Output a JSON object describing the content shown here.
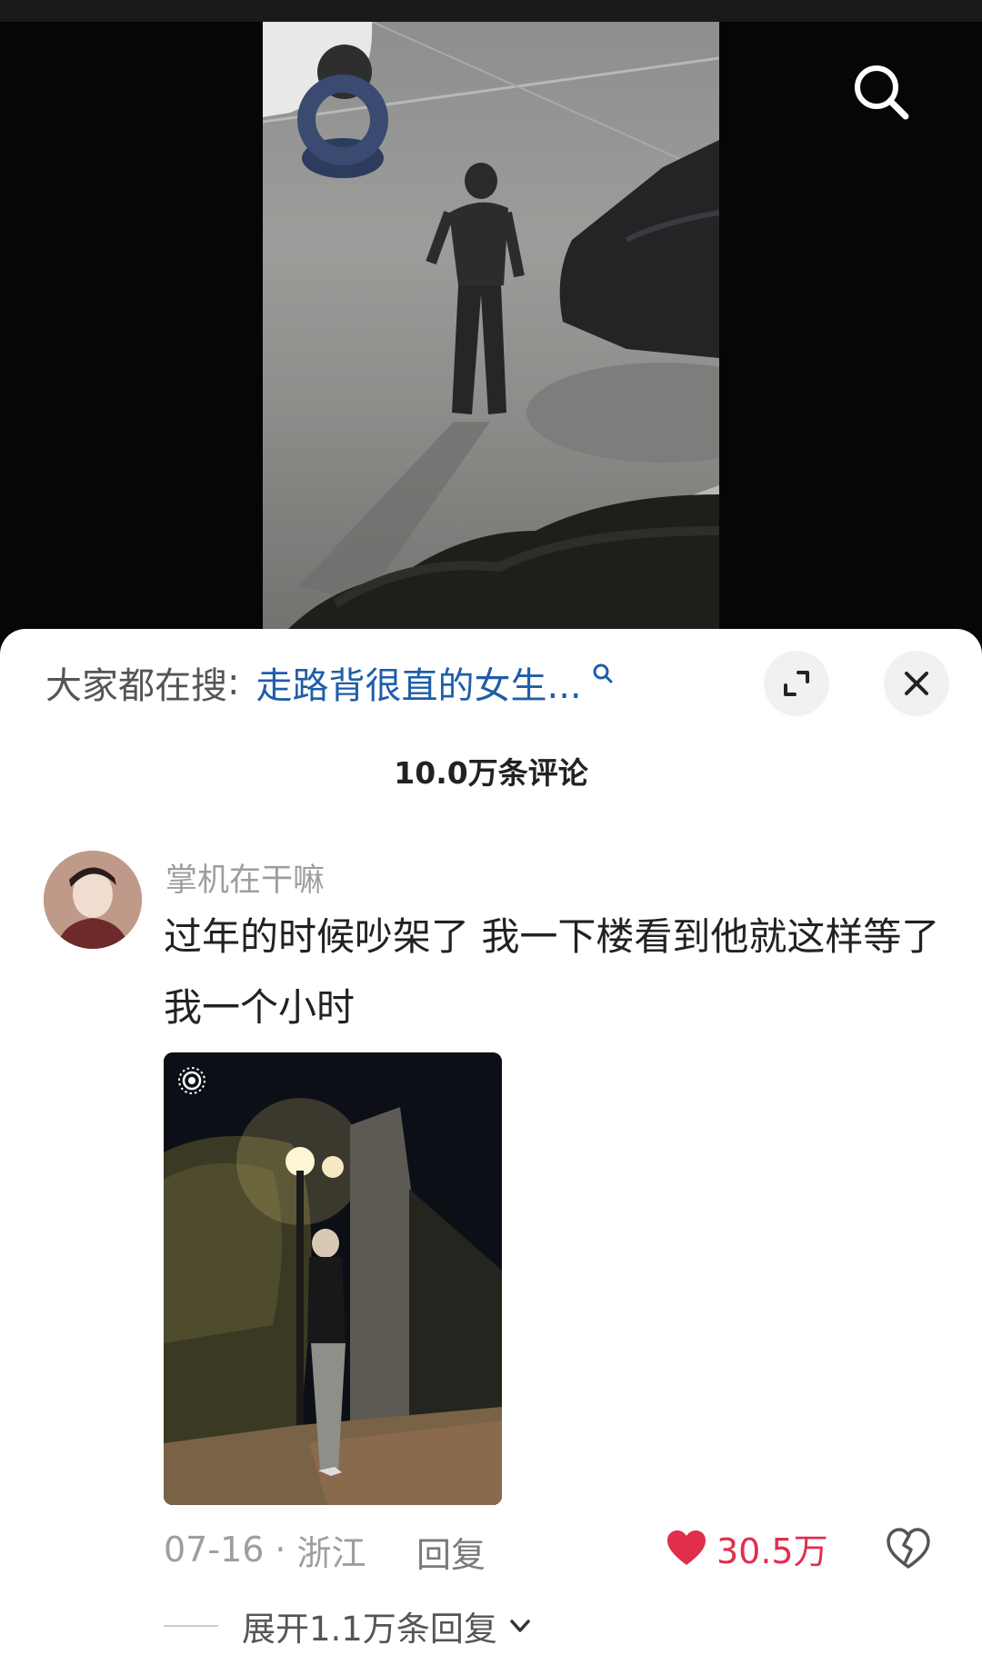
{
  "search": {
    "prefix": "大家都在搜",
    "colon": ":",
    "query": "走路背很直的女生..."
  },
  "comments_header": {
    "count_label": "10.0万条评论"
  },
  "comment": {
    "username": "掌机在干嘛",
    "text": "过年的时候吵架了 我一下楼看到他就这样等了我一个小时",
    "date": "07-16",
    "separator": "·",
    "location": "浙江",
    "reply_label": "回复",
    "like_count": "30.5万",
    "expand_label": "展开1.1万条回复"
  },
  "icons": {
    "search": "search-icon",
    "expand": "expand-icon",
    "close": "close-icon",
    "live_photo": "live-photo-icon",
    "like": "heart-icon",
    "dislike": "broken-heart-icon",
    "chevron": "chevron-down-icon"
  },
  "colors": {
    "accent_red": "#e02e4c",
    "link_blue": "#1f5ea8"
  }
}
